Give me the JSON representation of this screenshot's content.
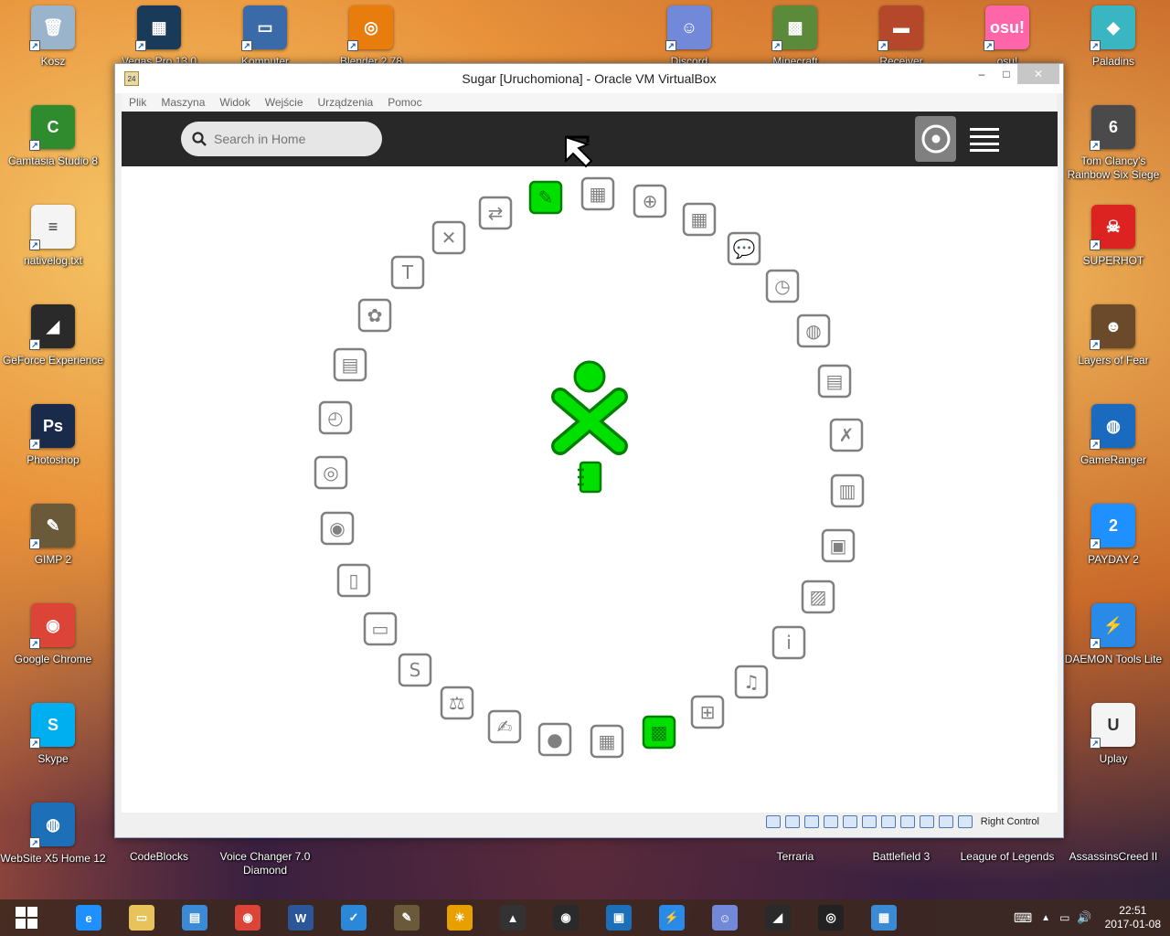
{
  "desktop": {
    "left_icons": [
      {
        "label": "Kosz",
        "icon": "recycle-bin-icon",
        "color": "#9ab4cc",
        "glyph": "🗑"
      },
      {
        "label": "Camtasia Studio 8",
        "icon": "camtasia-icon",
        "color": "#2e8b2e",
        "glyph": "C"
      },
      {
        "label": "nativelog.txt",
        "icon": "text-file-icon",
        "color": "#f4f4f4",
        "glyph": "≡"
      },
      {
        "label": "GeForce Experience",
        "icon": "geforce-icon",
        "color": "#2a2a2a",
        "glyph": "◢"
      },
      {
        "label": "Photoshop",
        "icon": "photoshop-icon",
        "color": "#1a2a4a",
        "glyph": "Ps"
      },
      {
        "label": "GIMP 2",
        "icon": "gimp-icon",
        "color": "#6b5a3a",
        "glyph": "✎"
      },
      {
        "label": "Google Chrome",
        "icon": "chrome-icon",
        "color": "#db4437",
        "glyph": "◉"
      },
      {
        "label": "Skype",
        "icon": "skype-icon",
        "color": "#00aff0",
        "glyph": "S"
      },
      {
        "label": "WebSite X5 Home 12",
        "icon": "website-x5-icon",
        "color": "#1d6fb8",
        "glyph": "◍"
      }
    ],
    "top_icons": [
      {
        "label": "Vegas Pro 13.0",
        "icon": "vegas-icon",
        "color": "#1a3a5a",
        "glyph": "▦"
      },
      {
        "label": "Komputer",
        "icon": "computer-icon",
        "color": "#3a6aa8",
        "glyph": "▭"
      },
      {
        "label": "Blender 2.78",
        "icon": "blender-icon",
        "color": "#e87d0d",
        "glyph": "◎"
      },
      {
        "label": "Discord",
        "icon": "discord-icon",
        "color": "#7289da",
        "glyph": "☺"
      },
      {
        "label": "Minecraft",
        "icon": "minecraft-icon",
        "color": "#5a8a3a",
        "glyph": "▩"
      },
      {
        "label": "Receiver",
        "icon": "receiver-icon",
        "color": "#b5482a",
        "glyph": "▬"
      },
      {
        "label": "osu!",
        "icon": "osu-icon",
        "color": "#ff66aa",
        "glyph": "osu!"
      }
    ],
    "right_icons": [
      {
        "label": "Paladins",
        "icon": "paladins-icon",
        "color": "#3ab6c2",
        "glyph": "◆"
      },
      {
        "label": "Tom Clancy's Rainbow Six Siege",
        "icon": "rainbow-six-icon",
        "color": "#4a4a4a",
        "glyph": "6"
      },
      {
        "label": "SUPERHOT",
        "icon": "superhot-icon",
        "color": "#d22",
        "glyph": "☠"
      },
      {
        "label": "Layers of Fear",
        "icon": "layers-of-fear-icon",
        "color": "#6a4a2a",
        "glyph": "☻"
      },
      {
        "label": "GameRanger",
        "icon": "gameranger-icon",
        "color": "#1a6abf",
        "glyph": "◍"
      },
      {
        "label": "PAYDAY 2",
        "icon": "payday-icon",
        "color": "#1e90ff",
        "glyph": "2"
      },
      {
        "label": "DAEMON Tools Lite",
        "icon": "daemon-tools-icon",
        "color": "#2a8ae8",
        "glyph": "⚡"
      },
      {
        "label": "Uplay",
        "icon": "uplay-icon",
        "color": "#f4f4f4",
        "glyph": "U"
      }
    ],
    "bottom_icons": [
      {
        "label": "CodeBlocks",
        "icon": "codeblocks-icon"
      },
      {
        "label": "Voice Changer 7.0 Diamond",
        "icon": "voice-changer-icon"
      },
      {
        "label": "Terraria",
        "icon": "terraria-icon"
      },
      {
        "label": "Battlefield 3",
        "icon": "battlefield-icon"
      },
      {
        "label": "League of Legends",
        "icon": "league-icon"
      },
      {
        "label": "AssassinsCreed II",
        "icon": "assassins-creed-icon"
      }
    ]
  },
  "vbox": {
    "title": "Sugar [Uruchomiona] - Oracle VM VirtualBox",
    "menu": [
      "Plik",
      "Maszyna",
      "Widok",
      "Wejście",
      "Urządzenia",
      "Pomoc"
    ],
    "host_key": "Right Control",
    "minimize": "–",
    "maximize": "□",
    "close": "✕"
  },
  "sugar": {
    "search_placeholder": "Search in Home",
    "xo_color_fill": "#00e000",
    "xo_color_stroke": "#008000",
    "activities": [
      {
        "name": "write",
        "color": "green"
      },
      {
        "name": "abacus",
        "color": "gray"
      },
      {
        "name": "browse",
        "color": "gray"
      },
      {
        "name": "calculate",
        "color": "gray"
      },
      {
        "name": "chat",
        "color": "gray"
      },
      {
        "name": "clock",
        "color": "gray"
      },
      {
        "name": "world-map",
        "color": "gray"
      },
      {
        "name": "fototoon",
        "color": "gray"
      },
      {
        "name": "speak",
        "color": "gray"
      },
      {
        "name": "help",
        "color": "gray"
      },
      {
        "name": "share-class",
        "color": "gray"
      },
      {
        "name": "image-viewer",
        "color": "gray"
      },
      {
        "name": "physics",
        "color": "gray"
      },
      {
        "name": "music",
        "color": "gray"
      },
      {
        "name": "mind-map",
        "color": "gray"
      },
      {
        "name": "maze",
        "color": "green"
      },
      {
        "name": "memorize",
        "color": "gray"
      },
      {
        "name": "moon",
        "color": "gray"
      },
      {
        "name": "paint",
        "color": "gray"
      },
      {
        "name": "measure",
        "color": "gray"
      },
      {
        "name": "pippy",
        "color": "gray"
      },
      {
        "name": "presentation",
        "color": "gray"
      },
      {
        "name": "read",
        "color": "gray"
      },
      {
        "name": "record",
        "color": "gray"
      },
      {
        "name": "speak-face",
        "color": "gray"
      },
      {
        "name": "stopwatch",
        "color": "gray"
      },
      {
        "name": "story",
        "color": "gray"
      },
      {
        "name": "turtle-art",
        "color": "gray"
      },
      {
        "name": "typing-turtle",
        "color": "gray"
      },
      {
        "name": "tic-tac-toe",
        "color": "gray"
      },
      {
        "name": "terminal",
        "color": "gray"
      }
    ]
  },
  "taskbar": {
    "items": [
      {
        "name": "ie",
        "glyph": "e",
        "color": "#1e90ff"
      },
      {
        "name": "explorer",
        "glyph": "▭",
        "color": "#e8c25a"
      },
      {
        "name": "file-manager",
        "glyph": "▤",
        "color": "#3a8ad6"
      },
      {
        "name": "chrome",
        "glyph": "◉",
        "color": "#db4437"
      },
      {
        "name": "word",
        "glyph": "W",
        "color": "#2b579a"
      },
      {
        "name": "wunderlist",
        "glyph": "✓",
        "color": "#2b88d9"
      },
      {
        "name": "gimp",
        "glyph": "✎",
        "color": "#6b5a3a"
      },
      {
        "name": "sun",
        "glyph": "☀",
        "color": "#e8a000"
      },
      {
        "name": "inkscape",
        "glyph": "▲",
        "color": "#333"
      },
      {
        "name": "camera",
        "glyph": "◉",
        "color": "#2a2a2a"
      },
      {
        "name": "virtualbox",
        "glyph": "▣",
        "color": "#1c6fb8"
      },
      {
        "name": "daemon",
        "glyph": "⚡",
        "color": "#2a8ae8"
      },
      {
        "name": "discord",
        "glyph": "☺",
        "color": "#7289da"
      },
      {
        "name": "geforce",
        "glyph": "◢",
        "color": "#2a2a2a"
      },
      {
        "name": "obs",
        "glyph": "◎",
        "color": "#222"
      },
      {
        "name": "network",
        "glyph": "▦",
        "color": "#3a8ad6"
      }
    ],
    "time": "22:51",
    "date": "2017-01-08"
  }
}
